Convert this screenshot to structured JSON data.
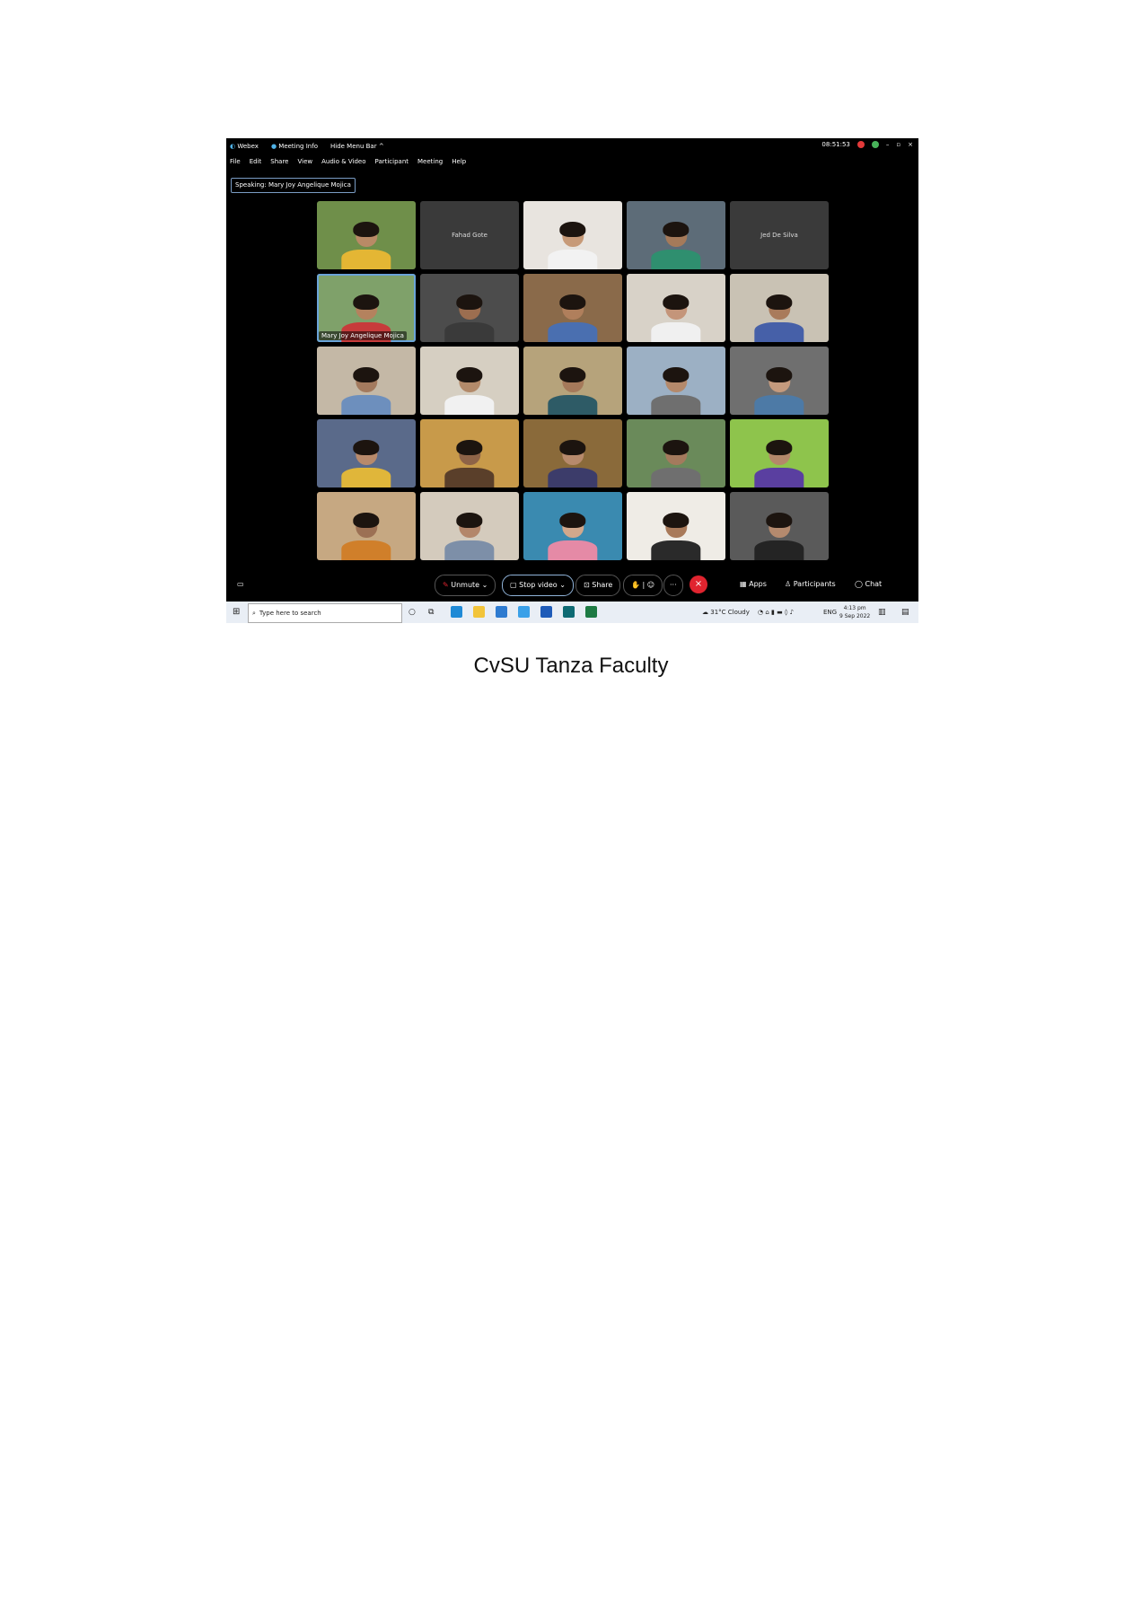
{
  "window": {
    "app_name": "Webex",
    "meeting_info": "Meeting Info",
    "hide_menu_bar": "Hide Menu Bar",
    "time": "08:51:53"
  },
  "menu": [
    "File",
    "Edit",
    "Share",
    "View",
    "Audio & Video",
    "Participant",
    "Meeting",
    "Help"
  ],
  "speaking_label": "Speaking: Mary Joy Angelique Mojica",
  "participants": [
    {
      "name": "",
      "video": true,
      "bg": "#6f8f4a",
      "skin": "#b98a66",
      "shirt": "#e4b634"
    },
    {
      "name": "Fahad Gote",
      "video": false
    },
    {
      "name": "",
      "video": true,
      "bg": "#e8e4df",
      "skin": "#c79a78",
      "shirt": "#f2f2f2"
    },
    {
      "name": "",
      "video": true,
      "bg": "#5d6c78",
      "skin": "#a57a5a",
      "shirt": "#2f8f6f"
    },
    {
      "name": "Jed De Silva",
      "video": false
    },
    {
      "name": "Mary Joy Angelique Mojica",
      "video": true,
      "active": true,
      "bg": "#7fa16a",
      "skin": "#b4825e",
      "shirt": "#c73b3b"
    },
    {
      "name": "",
      "video": true,
      "bg": "#4c4c4c",
      "skin": "#9c6e50",
      "shirt": "#3a3a3a"
    },
    {
      "name": "",
      "video": true,
      "bg": "#8a6a4a",
      "skin": "#b07f5c",
      "shirt": "#4a6fb0"
    },
    {
      "name": "",
      "video": true,
      "bg": "#d8d2c8",
      "skin": "#c4957a",
      "shirt": "#f0f0f0"
    },
    {
      "name": "",
      "video": true,
      "bg": "#c9c2b4",
      "skin": "#a97b5b",
      "shirt": "#4660a8"
    },
    {
      "name": "",
      "video": true,
      "bg": "#c4b8a6",
      "skin": "#a37a5e",
      "shirt": "#6d8fbd"
    },
    {
      "name": "",
      "video": true,
      "bg": "#d6cfc2",
      "skin": "#b38a6a",
      "shirt": "#f1f1f1"
    },
    {
      "name": "",
      "video": true,
      "bg": "#b6a37b",
      "skin": "#a5795a",
      "shirt": "#2e5b66"
    },
    {
      "name": "",
      "video": true,
      "bg": "#9cb0c4",
      "skin": "#b4896b",
      "shirt": "#6f6f6f"
    },
    {
      "name": "",
      "video": true,
      "bg": "#6f6f6f",
      "skin": "#c49a7d",
      "shirt": "#4d7aa6"
    },
    {
      "name": "",
      "video": true,
      "bg": "#5a6a8a",
      "skin": "#b88a6b",
      "shirt": "#e0b63a"
    },
    {
      "name": "",
      "video": true,
      "bg": "#c89a4a",
      "skin": "#8e6347",
      "shirt": "#5a3f2a"
    },
    {
      "name": "",
      "video": true,
      "bg": "#8a6a3a",
      "skin": "#b78a6c",
      "shirt": "#3c3c6a"
    },
    {
      "name": "",
      "video": true,
      "bg": "#6a8a5a",
      "skin": "#a47a5d",
      "shirt": "#6f6f6f"
    },
    {
      "name": "",
      "video": true,
      "bg": "#8ec44c",
      "skin": "#b4886a",
      "shirt": "#5a3fa0"
    },
    {
      "name": "",
      "video": true,
      "bg": "#c6a882",
      "skin": "#9c7054",
      "shirt": "#d07f2a"
    },
    {
      "name": "",
      "video": true,
      "bg": "#d4cbbd",
      "skin": "#b3866a",
      "shirt": "#7d8fa8"
    },
    {
      "name": "",
      "video": true,
      "bg": "#3a8ab0",
      "skin": "#d2a88c",
      "shirt": "#e58aa6"
    },
    {
      "name": "",
      "video": true,
      "bg": "#efece6",
      "skin": "#a97a5a",
      "shirt": "#2a2a2a"
    },
    {
      "name": "",
      "video": true,
      "bg": "#5a5a5a",
      "skin": "#b48a6e",
      "shirt": "#242424"
    }
  ],
  "controls": {
    "unmute": "Unmute",
    "stop_video": "Stop video",
    "share": "Share",
    "more": "···",
    "leave": "×",
    "apps": "Apps",
    "participants": "Participants",
    "chat": "Chat"
  },
  "taskbar": {
    "search_placeholder": "Type here to search",
    "weather": "31°C  Cloudy",
    "language": "ENG",
    "clock_time": "4:13 pm",
    "clock_date": "9 Sep 2022"
  },
  "caption": "CvSU Tanza Faculty",
  "colors": {
    "leave_button": "#e0242f",
    "active_speaker_border": "#6aa3d8"
  }
}
